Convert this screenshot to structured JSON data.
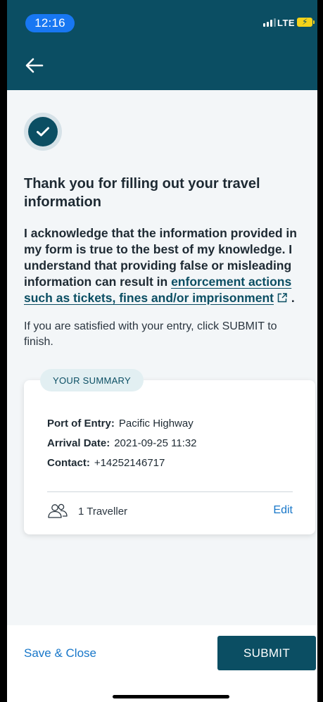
{
  "status_bar": {
    "time": "12:16",
    "network": "LTE"
  },
  "header": {
    "back_icon": "arrow-left-icon"
  },
  "main": {
    "success_icon": "check-circle-icon",
    "title": "Thank you for filling out your travel information",
    "ack_text_1": "I acknowledge that the information provided in my form is true to the best of my knowledge. I understand that providing false or misleading information can result in ",
    "ack_link": "enforcement actions such as tickets, fines and/or imprisonment",
    "ack_text_2": " .",
    "satisfied_text": "If you are satisfied with your entry, click SUBMIT to finish."
  },
  "summary": {
    "tag": "YOUR SUMMARY",
    "port_label": "Port of Entry:",
    "port_value": "Pacific Highway",
    "arrival_label": "Arrival Date:",
    "arrival_value": "2021-09-25 11:32",
    "contact_label": "Contact:",
    "contact_value": "+14252146717",
    "travellers": "1 Traveller",
    "edit_label": "Edit"
  },
  "footer": {
    "save_close_label": "Save & Close",
    "submit_label": "SUBMIT"
  },
  "colors": {
    "primary": "#0b4e63",
    "link": "#1877c9",
    "background": "#f3f6f8"
  }
}
